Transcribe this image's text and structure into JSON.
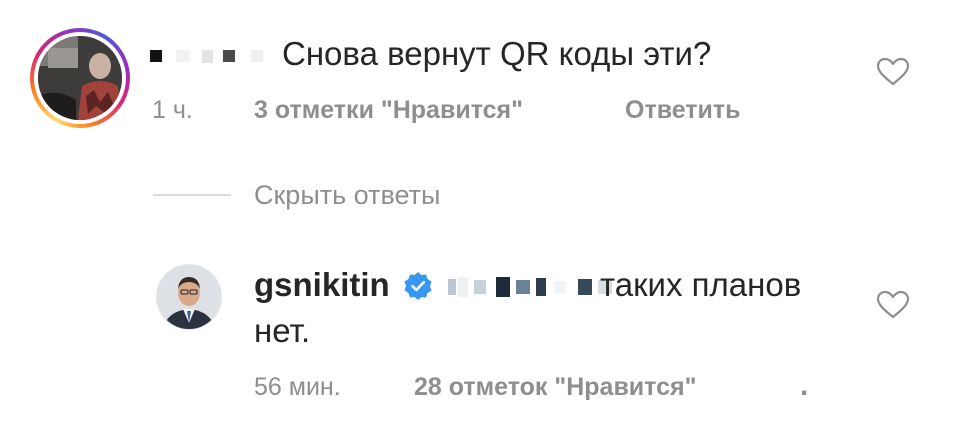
{
  "comments": [
    {
      "username_redacted": true,
      "text": "Снова вернут QR коды эти?",
      "time": "1 ч.",
      "likes": "3 отметки \"Нравится\"",
      "reply_label": "Ответить",
      "avatar_has_story_ring": true,
      "like_icon": "heart-outline-icon"
    }
  ],
  "hide_replies_label": "Скрыть ответы",
  "reply": {
    "username": "gsnikitin",
    "verified": true,
    "verified_icon": "verified-badge-icon",
    "mention_redacted": true,
    "text_line1": "таких планов",
    "text_line2": "нет.",
    "time": "56 мин.",
    "likes": "28 отметок \"Нравится\"",
    "more_label": ".",
    "like_icon": "heart-outline-icon"
  },
  "colors": {
    "text_primary": "#262626",
    "text_secondary": "#8e8e8e",
    "verified_blue": "#3897f0",
    "divider": "#dbdbdb"
  }
}
